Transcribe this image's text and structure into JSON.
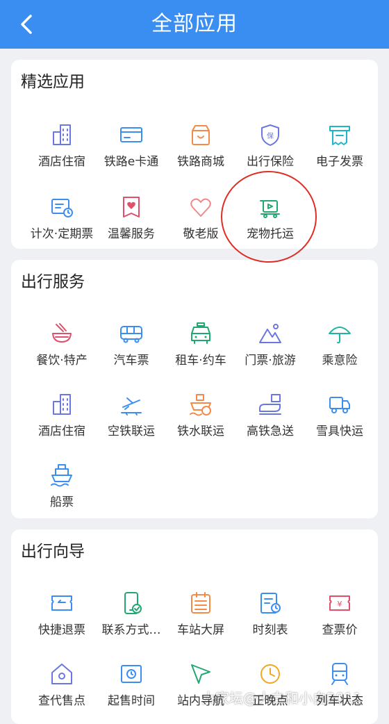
{
  "header": {
    "title": "全部应用"
  },
  "sections": [
    {
      "title": "精选应用",
      "items": [
        {
          "label": "酒店住宿",
          "icon": "hotel-icon",
          "color": "#6b77e0"
        },
        {
          "label": "铁路e卡通",
          "icon": "card-icon",
          "color": "#3a8ef2"
        },
        {
          "label": "铁路商城",
          "icon": "shop-icon",
          "color": "#f28a4a"
        },
        {
          "label": "出行保险",
          "icon": "shield-icon",
          "color": "#6b77e0"
        },
        {
          "label": "电子发票",
          "icon": "invoice-icon",
          "color": "#1db5c9"
        },
        {
          "label": "计次·定期票",
          "icon": "periodic-ticket-icon",
          "color": "#3a8ef2"
        },
        {
          "label": "温馨服务",
          "icon": "care-icon",
          "color": "#e0506a"
        },
        {
          "label": "敬老版",
          "icon": "heart-icon",
          "color": "#f08a8a"
        },
        {
          "label": "宠物托运",
          "icon": "pet-carrier-icon",
          "color": "#20a870"
        }
      ]
    },
    {
      "title": "出行服务",
      "items": [
        {
          "label": "餐饮·特产",
          "icon": "food-bowl-icon",
          "color": "#e0506a"
        },
        {
          "label": "汽车票",
          "icon": "bus-icon",
          "color": "#3a8ef2"
        },
        {
          "label": "租车·约车",
          "icon": "taxi-icon",
          "color": "#20a870"
        },
        {
          "label": "门票·旅游",
          "icon": "mountain-icon",
          "color": "#6b77e0"
        },
        {
          "label": "乘意险",
          "icon": "umbrella-icon",
          "color": "#1db5a9"
        },
        {
          "label": "酒店住宿",
          "icon": "hotel-icon",
          "color": "#6b77e0"
        },
        {
          "label": "空铁联运",
          "icon": "plane-train-icon",
          "color": "#3a8ef2"
        },
        {
          "label": "铁水联运",
          "icon": "ship-train-icon",
          "color": "#f28a4a"
        },
        {
          "label": "高铁急送",
          "icon": "express-train-icon",
          "color": "#6b77e0"
        },
        {
          "label": "雪具快运",
          "icon": "truck-icon",
          "color": "#3a8ef2"
        },
        {
          "label": "船票",
          "icon": "boat-icon",
          "color": "#3a8ef2"
        }
      ]
    },
    {
      "title": "出行向导",
      "items": [
        {
          "label": "快捷退票",
          "icon": "refund-ticket-icon",
          "color": "#3a8ef2"
        },
        {
          "label": "联系方式…",
          "icon": "contact-phone-icon",
          "color": "#20a870"
        },
        {
          "label": "车站大屏",
          "icon": "station-screen-icon",
          "color": "#f28a4a"
        },
        {
          "label": "时刻表",
          "icon": "timetable-icon",
          "color": "#3a8ef2"
        },
        {
          "label": "查票价",
          "icon": "price-ticket-icon",
          "color": "#e0506a"
        },
        {
          "label": "查代售点",
          "icon": "outlet-house-icon",
          "color": "#6b77e0"
        },
        {
          "label": "起售时间",
          "icon": "sale-time-icon",
          "color": "#3a8ef2"
        },
        {
          "label": "站内导航",
          "icon": "navigation-arrow-icon",
          "color": "#20a870"
        },
        {
          "label": "正晚点",
          "icon": "clock-icon",
          "color": "#f2a81d"
        },
        {
          "label": "列车状态",
          "icon": "train-status-icon",
          "color": "#3a8ef2"
        }
      ]
    }
  ],
  "watermark": "大家坛@大白和小白2011"
}
